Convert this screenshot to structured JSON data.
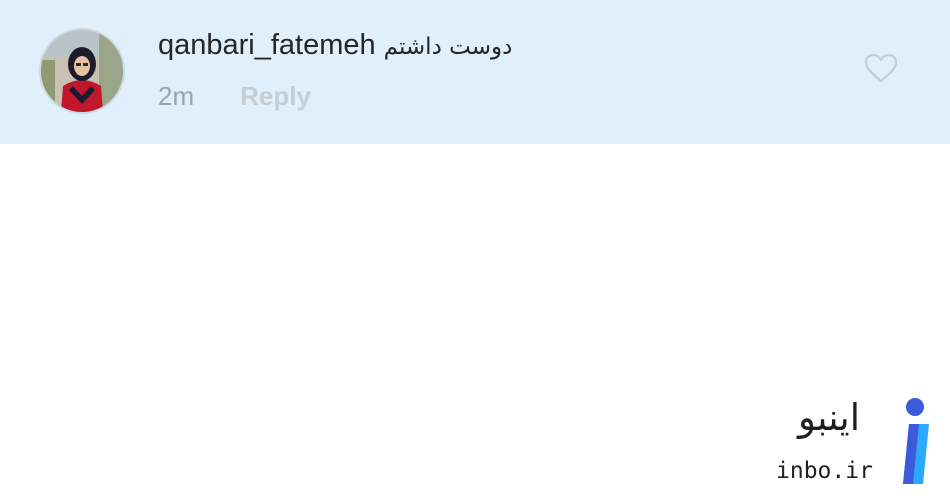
{
  "comment": {
    "username": "qanbari_fatemeh",
    "text": "دوست داشتم",
    "time": "2m",
    "reply_label": "Reply",
    "like_icon": "heart-outline-icon",
    "avatar_icon": "user-avatar"
  },
  "watermark": {
    "name": "اینبو",
    "domain": "inbo.ir",
    "logo_icon": "inbo-logo-icon"
  },
  "colors": {
    "row_background": "#dfeffc",
    "username": "#262626",
    "time": "#9aa4ac",
    "reply": "#c6ced5",
    "logo_blue": "#3b5bdb",
    "logo_cyan": "#2ba8ff"
  }
}
